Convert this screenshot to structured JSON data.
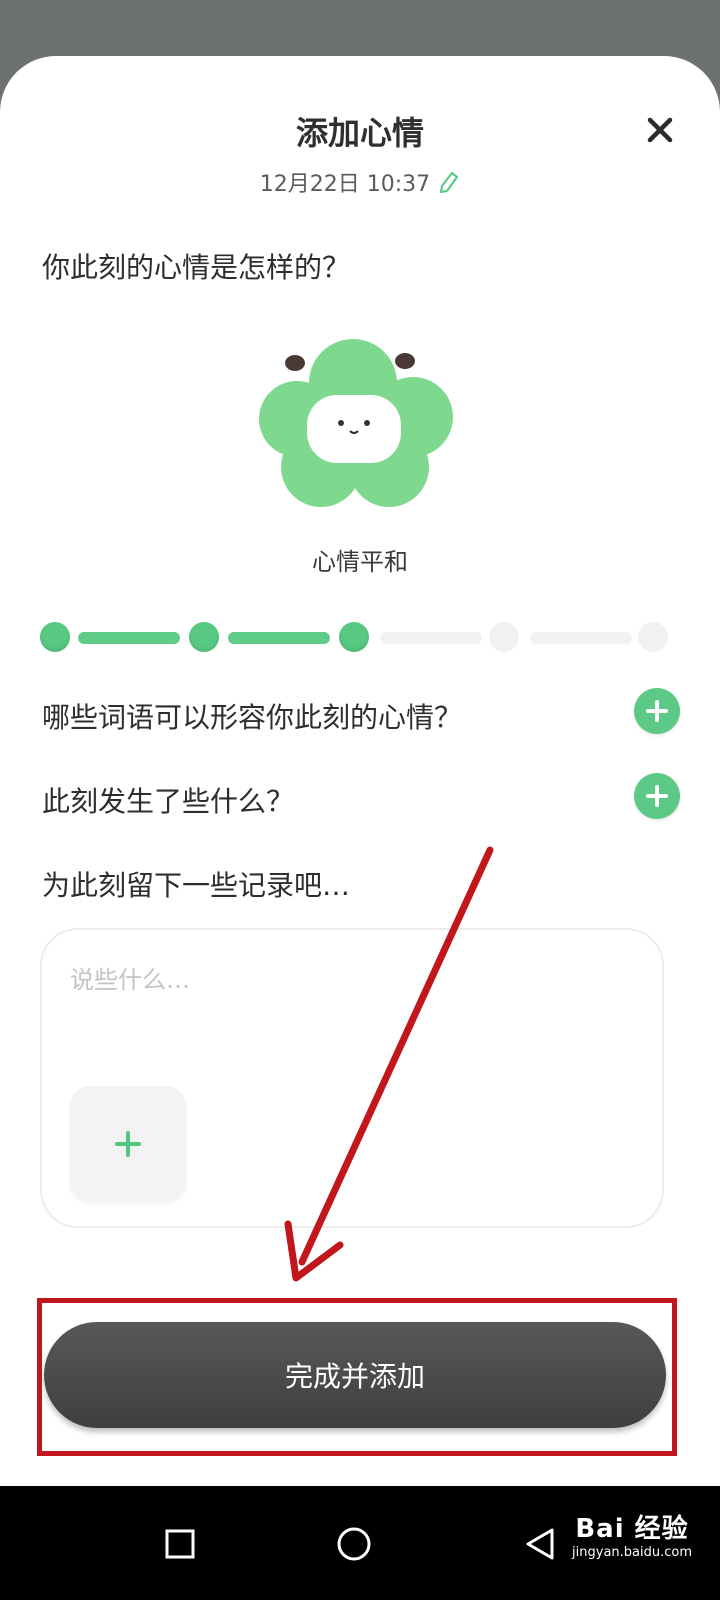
{
  "sheet": {
    "title": "添加心情",
    "datetime": "12月22日 10:37",
    "icons": {
      "close": "close-icon",
      "edit": "pencil-icon"
    }
  },
  "mood": {
    "question": "你此刻的心情是怎样的？",
    "label": "心情平和",
    "level": 3,
    "max_level": 5,
    "accent_color": "#58c982"
  },
  "sections": {
    "words_question": "哪些词语可以形容你此刻的心情？",
    "events_question": "此刻发生了些什么？",
    "record_prompt": "为此刻留下一些记录吧…"
  },
  "note": {
    "placeholder": "说些什么…"
  },
  "actions": {
    "done_label": "完成并添加"
  },
  "annotation": {
    "highlight_color": "#c1161b"
  },
  "watermark": {
    "logo": "Bai 经验",
    "url": "jingyan.baidu.com"
  }
}
